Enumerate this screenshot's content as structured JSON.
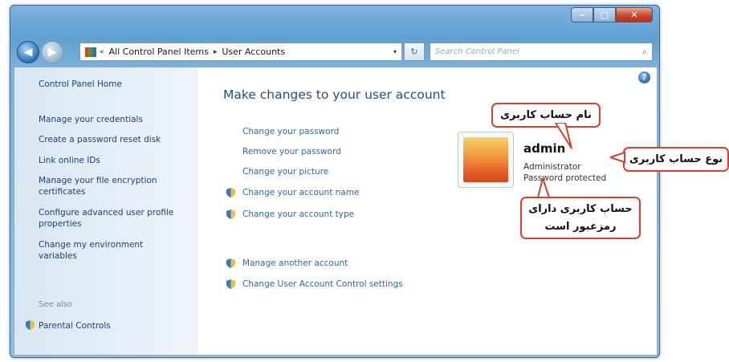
{
  "window": {
    "buttons": {
      "minimize": "–",
      "maximize": "□",
      "close": "✕"
    }
  },
  "navigation": {
    "back_icon": "◀",
    "forward_icon": "▶",
    "breadcrumb_prefix": "«",
    "breadcrumb": [
      "All Control Panel Items",
      "User Accounts"
    ],
    "separator": "▸",
    "dropdown": "▾",
    "refresh_icon": "↻",
    "search_placeholder": "Search Control Panel",
    "search_icon": "⌕"
  },
  "sidebar": {
    "home": "Control Panel Home",
    "links": [
      "Manage your credentials",
      "Create a password reset disk",
      "Link online IDs",
      "Manage your file encryption certificates",
      "Configure advanced user profile properties",
      "Change my environment variables"
    ],
    "see_also_heading": "See also",
    "parental_controls": "Parental Controls"
  },
  "main": {
    "title": "Make changes to your user account",
    "help_icon": "?",
    "tasks": [
      "Change your password",
      "Remove your password",
      "Change your picture",
      "Change your account name",
      "Change your account type"
    ],
    "other_tasks": [
      "Manage another account",
      "Change User Account Control settings"
    ]
  },
  "account": {
    "name": "admin",
    "type": "Administrator",
    "status": "Password protected"
  },
  "annotations": {
    "account_name": "نام حساب کاربری",
    "account_type": "نوع حساب کاربری",
    "password_line1": "حساب کاربری دارای",
    "password_line2": "رمزعبور است",
    "color": "#d9402b"
  }
}
